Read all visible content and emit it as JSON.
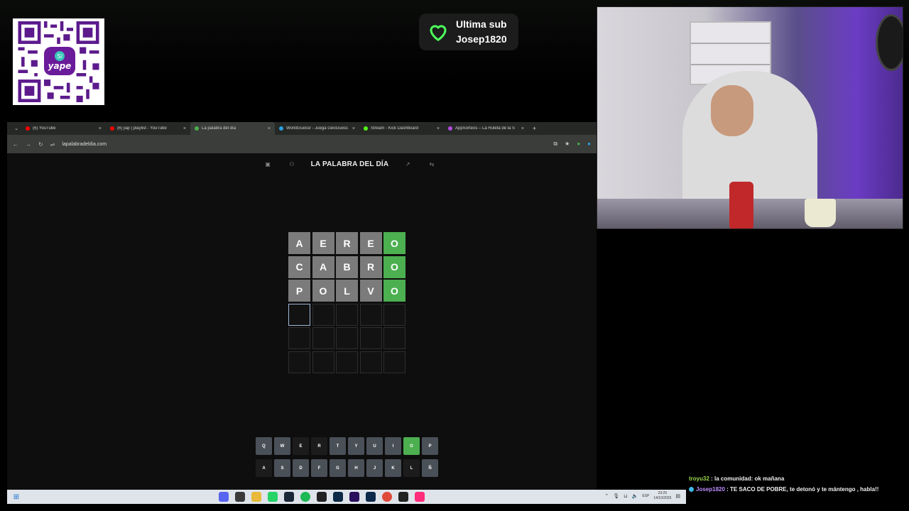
{
  "overlay": {
    "qr_brand": "yape",
    "qr_badge": "S/",
    "last_sub": {
      "heading": "Ultima sub",
      "username": "Josep1820",
      "accent": "#4cff5a"
    }
  },
  "browser": {
    "tabs": [
      {
        "label": "(6) YouTube",
        "favicon_color": "#ff0000"
      },
      {
        "label": "(6) jiaji | playlist - YouTube",
        "favicon_color": "#ff0000"
      },
      {
        "label": "La palabra del día",
        "favicon_color": "#4caf50",
        "active": true
      },
      {
        "label": "WorldGuessr - Juega GeoGuess",
        "favicon_color": "#2aa0e0"
      },
      {
        "label": "Stream - Kick Dashboard",
        "favicon_color": "#53fc18"
      },
      {
        "label": "AppSorteos – La Ruleta de la S",
        "favicon_color": "#b44be1"
      }
    ],
    "tab_close": "×",
    "new_tab": "+",
    "url": "lapalabradeldia.com"
  },
  "game": {
    "title": "LA PALABRA DEL DÍA",
    "guesses": [
      {
        "letters": [
          "A",
          "E",
          "R",
          "E",
          "O"
        ],
        "states": [
          "gray",
          "gray",
          "gray",
          "gray",
          "green"
        ]
      },
      {
        "letters": [
          "C",
          "A",
          "B",
          "R",
          "O"
        ],
        "states": [
          "gray",
          "gray",
          "gray",
          "gray",
          "green"
        ]
      },
      {
        "letters": [
          "P",
          "O",
          "L",
          "V",
          "O"
        ],
        "states": [
          "gray",
          "gray",
          "gray",
          "gray",
          "green"
        ]
      }
    ],
    "rows_total": 6,
    "keyboard": {
      "row1": [
        "Q",
        "W",
        "E",
        "R",
        "T",
        "Y",
        "U",
        "I",
        "O",
        "P"
      ],
      "row2": [
        "A",
        "S",
        "D",
        "F",
        "G",
        "H",
        "J",
        "K",
        "L",
        "Ñ"
      ],
      "used_row1": [
        "E",
        "R"
      ],
      "green_row1": [
        "O"
      ],
      "used_row2": [
        "A",
        "L"
      ]
    }
  },
  "taskbar": {
    "lang": "ESP",
    "time": "23:25",
    "date": "14/10/2025"
  },
  "chat": [
    {
      "user": "troyu32",
      "text": ": la comunidad: ok mañana"
    },
    {
      "user": "Josep1820",
      "text": ": TE SACO DE POBRE, te detonó y te mántengo , habla!!"
    }
  ]
}
